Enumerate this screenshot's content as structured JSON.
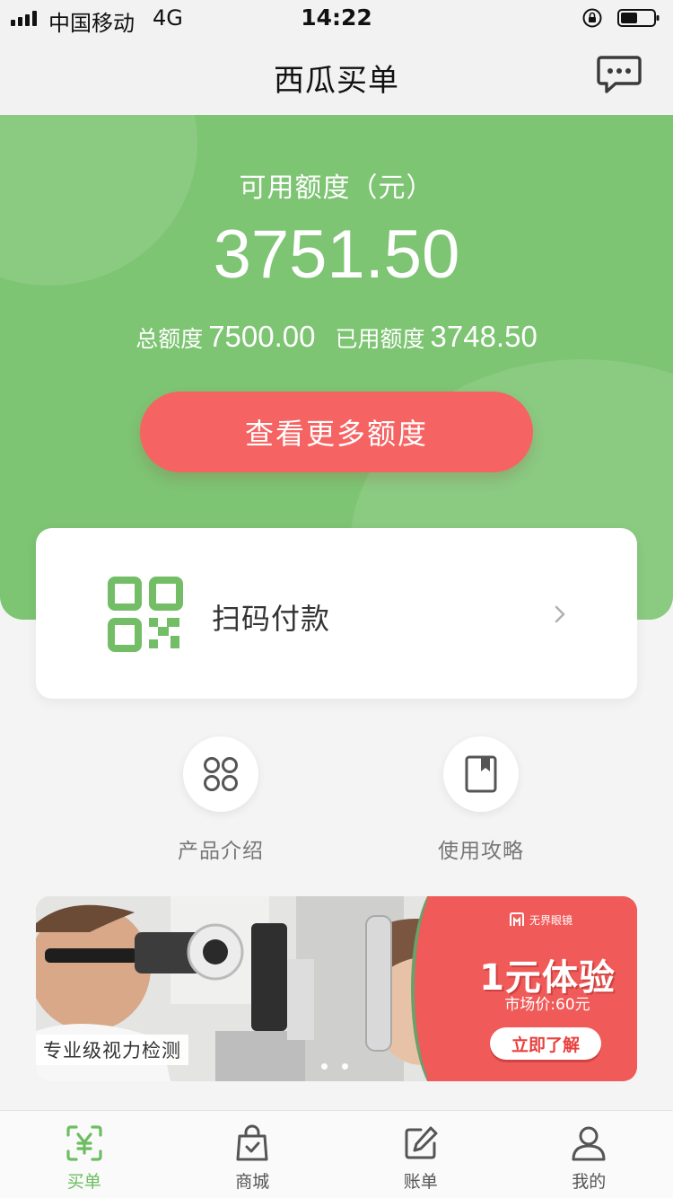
{
  "status_bar": {
    "carrier": "中国移动",
    "network": "4G",
    "time": "14:22"
  },
  "header": {
    "title": "西瓜买单",
    "chat_icon": "message-dots-icon"
  },
  "credit": {
    "available_label": "可用额度（元）",
    "available_amount": "3751.50",
    "total_label": "总额度",
    "total_amount": "7500.00",
    "used_label": "已用额度",
    "used_amount": "3748.50",
    "more_button_label": "查看更多额度"
  },
  "scan_card": {
    "label": "扫码付款",
    "icon": "qr-code-icon"
  },
  "quick_entries": [
    {
      "label": "产品介绍",
      "icon": "grid-icon"
    },
    {
      "label": "使用攻略",
      "icon": "book-icon"
    }
  ],
  "banner": {
    "caption": "专业级视力检测",
    "brand": "无界眼镜",
    "promo_title": "1元体验",
    "promo_price": "市场价:60元",
    "promo_button": "立即了解"
  },
  "tab_bar": {
    "items": [
      {
        "label": "买单",
        "icon": "yuan-scan-icon",
        "active": true
      },
      {
        "label": "商城",
        "icon": "shopping-bag-icon",
        "active": false
      },
      {
        "label": "账单",
        "icon": "edit-icon",
        "active": false
      },
      {
        "label": "我的",
        "icon": "user-icon",
        "active": false
      }
    ]
  },
  "colors": {
    "green": "#7dc473",
    "red_button": "#f56363",
    "tab_active": "#6dbd62"
  }
}
